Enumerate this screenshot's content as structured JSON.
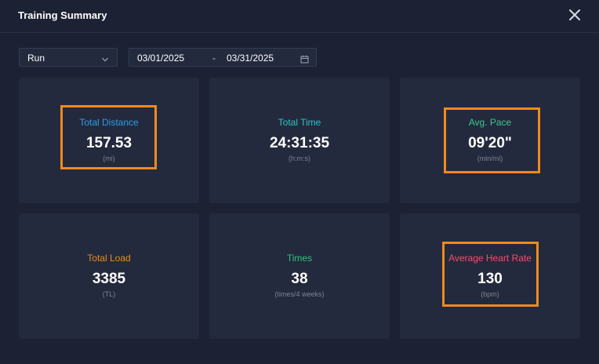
{
  "window": {
    "title": "Training Summary"
  },
  "filters": {
    "sport": "Run",
    "start_date": "03/01/2025",
    "separator": "-",
    "end_date": "03/31/2025"
  },
  "cards": [
    {
      "label": "Total Distance",
      "value": "157.53",
      "unit": "(mi)",
      "color": "#2f9ce8",
      "highlighted": true
    },
    {
      "label": "Total Time",
      "value": "24:31:35",
      "unit": "(h:m:s)",
      "color": "#2cc3c8",
      "highlighted": false
    },
    {
      "label": "Avg. Pace",
      "value": "09'20\"",
      "unit": "(min/mi)",
      "color": "#3cc88c",
      "highlighted": true
    },
    {
      "label": "Total Load",
      "value": "3385",
      "unit": "(TL)",
      "color": "#f08a1c",
      "highlighted": false
    },
    {
      "label": "Times",
      "value": "38",
      "unit": "(times/4 weeks)",
      "color": "#2fc47a",
      "highlighted": false
    },
    {
      "label": "Average Heart Rate",
      "value": "130",
      "unit": "(bpm)",
      "color": "#f0506a",
      "highlighted": true
    }
  ],
  "icons": {
    "close": "close-icon",
    "dropdown": "chevron-down-icon",
    "calendar": "calendar-icon"
  },
  "colors": {
    "background": "#1c2234",
    "card": "#232a3d",
    "highlight": "#f08a1c"
  }
}
